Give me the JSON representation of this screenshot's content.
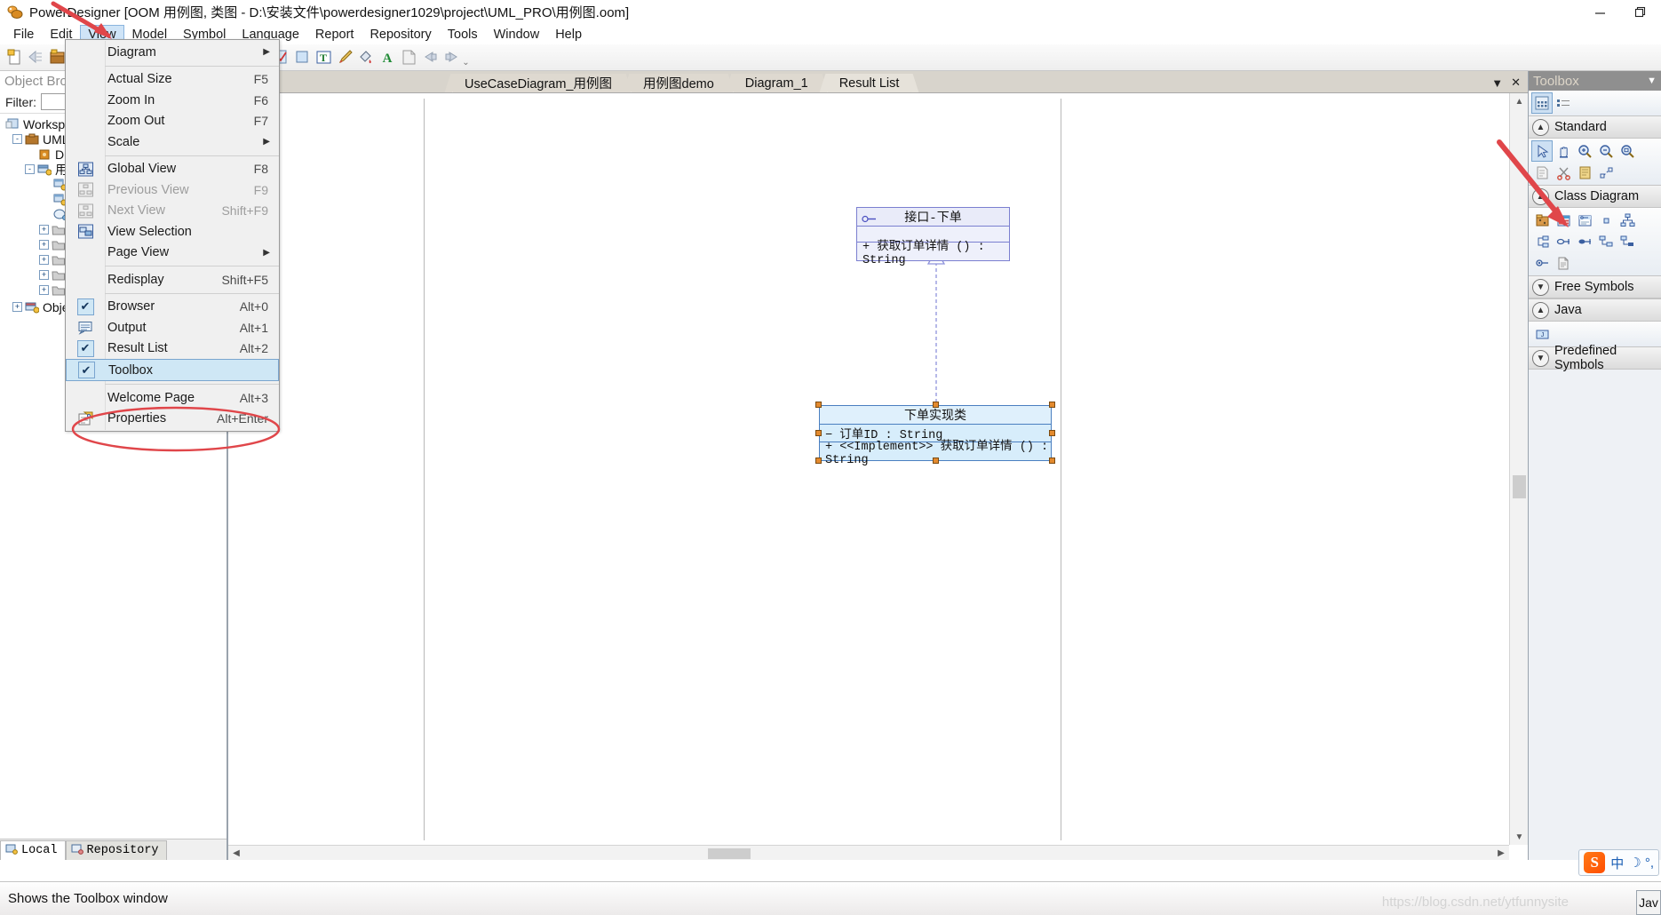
{
  "window": {
    "title": "PowerDesigner [OOM 用例图, 类图 - D:\\安装文件\\powerdesigner1029\\project\\UML_PRO\\用例图.oom]",
    "icon": "powerdesigner-icon",
    "minimize": "—",
    "restore": "❐",
    "close": ""
  },
  "menubar": {
    "items": [
      {
        "label": "File",
        "name": "menu-file"
      },
      {
        "label": "Edit",
        "name": "menu-edit"
      },
      {
        "label": "View",
        "name": "menu-view",
        "open": true
      },
      {
        "label": "Model",
        "name": "menu-model"
      },
      {
        "label": "Symbol",
        "name": "menu-symbol"
      },
      {
        "label": "Language",
        "name": "menu-language"
      },
      {
        "label": "Report",
        "name": "menu-report"
      },
      {
        "label": "Repository",
        "name": "menu-repository"
      },
      {
        "label": "Tools",
        "name": "menu-tools"
      },
      {
        "label": "Window",
        "name": "menu-window"
      },
      {
        "label": "Help",
        "name": "menu-help"
      }
    ]
  },
  "view_menu": {
    "items": [
      {
        "label": "Diagram",
        "accel": "",
        "submenu": true,
        "icon": "",
        "checked": false,
        "disabled": false
      },
      {
        "sep": true
      },
      {
        "label": "Actual Size",
        "accel": "F5",
        "icon": "",
        "checked": false,
        "disabled": false
      },
      {
        "label": "Zoom In",
        "accel": "F6",
        "icon": "",
        "checked": false,
        "disabled": false
      },
      {
        "label": "Zoom Out",
        "accel": "F7",
        "icon": "",
        "checked": false,
        "disabled": false
      },
      {
        "label": "Scale",
        "accel": "",
        "submenu": true,
        "icon": "",
        "checked": false,
        "disabled": false
      },
      {
        "sep": true
      },
      {
        "label": "Global View",
        "accel": "F8",
        "icon": "global-view-icon",
        "checked": false,
        "disabled": false
      },
      {
        "label": "Previous View",
        "accel": "F9",
        "icon": "previous-view-icon",
        "checked": false,
        "disabled": true
      },
      {
        "label": "Next View",
        "accel": "Shift+F9",
        "icon": "next-view-icon",
        "checked": false,
        "disabled": true
      },
      {
        "label": "View Selection",
        "accel": "",
        "icon": "view-selection-icon",
        "checked": false,
        "disabled": false
      },
      {
        "label": "Page View",
        "accel": "",
        "submenu": true,
        "icon": "",
        "checked": false,
        "disabled": false
      },
      {
        "sep": true
      },
      {
        "label": "Redisplay",
        "accel": "Shift+F5",
        "icon": "",
        "checked": false,
        "disabled": false
      },
      {
        "sep": true
      },
      {
        "label": "Browser",
        "accel": "Alt+0",
        "icon": "check",
        "checked": true,
        "disabled": false
      },
      {
        "label": "Output",
        "accel": "Alt+1",
        "icon": "output-icon",
        "checked": false,
        "disabled": false
      },
      {
        "label": "Result List",
        "accel": "Alt+2",
        "icon": "check",
        "checked": true,
        "disabled": false
      },
      {
        "label": "Toolbox",
        "accel": "",
        "icon": "check",
        "checked": true,
        "disabled": false,
        "highlighted": true
      },
      {
        "sep": true
      },
      {
        "label": "Welcome Page",
        "accel": "Alt+3",
        "icon": "",
        "checked": false,
        "disabled": false
      },
      {
        "label": "Properties",
        "accel": "Alt+Enter",
        "icon": "properties-icon",
        "checked": false,
        "disabled": false
      }
    ]
  },
  "toolbar": {
    "groups": [
      {
        "name": "file-group",
        "buttons": [
          "new-model-icon",
          "generate-icon",
          "open-workspace-icon"
        ]
      },
      {
        "name": "edit-group",
        "buttons": [
          "undo-icon",
          "redo-icon",
          "properties-icon",
          "help-icon"
        ]
      },
      {
        "name": "object-group",
        "buttons": [
          "new-object-icon",
          "paste-icon",
          "find-icon",
          "refresh-icon",
          "check-model-icon",
          "fill-icon",
          "text-box-icon",
          "pencil-icon",
          "fill-color-icon",
          "font-color-icon",
          "note-icon",
          "back-icon",
          "forward-icon"
        ]
      }
    ]
  },
  "browser": {
    "title": "Object Brow",
    "filter_label": "Filter:",
    "filter_value": "",
    "tree": [
      {
        "label": "Workspa",
        "indent": 0,
        "expander": "",
        "icon": "workspace-icon"
      },
      {
        "label": "UML_",
        "indent": 1,
        "expander": "-",
        "icon": "model-icon"
      },
      {
        "label": "Dia",
        "indent": 2,
        "expander": "",
        "icon": "diagram-folder-icon"
      },
      {
        "label": "用",
        "indent": 2,
        "expander": "-",
        "icon": "class-diagram-icon"
      },
      {
        "label": "",
        "indent": 3,
        "expander": "",
        "icon": "diagram-icon"
      },
      {
        "label": "",
        "indent": 3,
        "expander": "",
        "icon": "diagram-icon"
      },
      {
        "label": "",
        "indent": 3,
        "expander": "",
        "icon": "usecase-icon"
      },
      {
        "label": "",
        "indent": 3,
        "expander": "+",
        "icon": "folder-icon"
      },
      {
        "label": "",
        "indent": 3,
        "expander": "+",
        "icon": "folder-icon"
      },
      {
        "label": "",
        "indent": 3,
        "expander": "+",
        "icon": "folder-icon"
      },
      {
        "label": "",
        "indent": 3,
        "expander": "+",
        "icon": "folder-icon"
      },
      {
        "label": "",
        "indent": 3,
        "expander": "+",
        "icon": "folder-icon"
      },
      {
        "label": "Objec",
        "indent": 1,
        "expander": "+",
        "icon": "class-diagram-icon"
      }
    ],
    "tabs": [
      {
        "label": "Local",
        "icon": "local-icon",
        "active": true
      },
      {
        "label": "Repository",
        "icon": "repository-icon",
        "active": false
      }
    ]
  },
  "diagram": {
    "tabs": [
      {
        "label": "UseCaseDiagram_用例图",
        "active": false
      },
      {
        "label": "用例图demo",
        "active": false
      },
      {
        "label": "Diagram_1",
        "active": false
      },
      {
        "label": "Result List",
        "active": true
      }
    ],
    "tab_controls": {
      "minimize": "▼",
      "close": "✕"
    },
    "shapes": [
      {
        "name": "interface-shape",
        "type": "interface",
        "title": "接口-下单",
        "icon": "lollipop-icon",
        "attributes": [],
        "operations": [
          "+  获取订单详情 ()  :  String"
        ],
        "selected": false
      },
      {
        "name": "class-shape",
        "type": "class",
        "title": "下单实现类",
        "attributes": [
          "−  订单ID  :  String"
        ],
        "operations": [
          "+  <<Implement>>  获取订单详情 ()  :  String"
        ],
        "selected": true
      }
    ],
    "link": {
      "name": "realization-link",
      "type": "realization",
      "style": "dashed-triangle"
    }
  },
  "toolbox": {
    "title": "Toolbox",
    "header_caret": "▼",
    "top_buttons": [
      "grid-icon",
      "list-icon"
    ],
    "sections": [
      {
        "label": "Standard",
        "name": "toolbox-section-standard",
        "expanded": true,
        "chevron": "▲",
        "tools": [
          "pointer-icon",
          "pan-icon",
          "zoom-in-icon",
          "zoom-out-icon",
          "zoom-area-icon",
          "note-icon",
          "scissors-icon",
          "paste-icon",
          "link-icon"
        ]
      },
      {
        "label": "Class Diagram",
        "name": "toolbox-section-class-diagram",
        "expanded": true,
        "chevron": "▲",
        "tools": [
          "package-icon",
          "class-icon",
          "interface-icon",
          "port-icon",
          "generalization-icon",
          "association-icon",
          "dependency-icon",
          "realization-icon",
          "aggregation-icon",
          "composition-icon",
          "inner-link-icon",
          "file-icon"
        ]
      },
      {
        "label": "Free Symbols",
        "name": "toolbox-section-free-symbols",
        "expanded": false,
        "chevron": "▼",
        "tools": []
      },
      {
        "label": "Java",
        "name": "toolbox-section-java",
        "expanded": true,
        "chevron": "▲",
        "tools": [
          "java-applet-icon"
        ]
      },
      {
        "label": "Predefined Symbols",
        "name": "toolbox-section-predefined-symbols",
        "expanded": false,
        "chevron": "▼",
        "tools": []
      }
    ]
  },
  "statusbar": {
    "message": "Shows the Toolbox window"
  },
  "watermark": "https://blog.csdn.net/ytfunnysite",
  "ime": {
    "logo": "S",
    "mode": "中",
    "glyphs": "☽  °,"
  },
  "java_chip": "Jav",
  "colors": {
    "accent": "#cfe7f5",
    "accent_border": "#7aa5cf",
    "annotation": "#e0464a",
    "uml_border": "#7b7fd0",
    "uml_fill": "#eef0fb",
    "class_fill": "#d5ecfb",
    "selection_handle": "#e38a2e",
    "titlebar_bg": "#ffffff",
    "toolbox_header": "#8f8f8f"
  }
}
